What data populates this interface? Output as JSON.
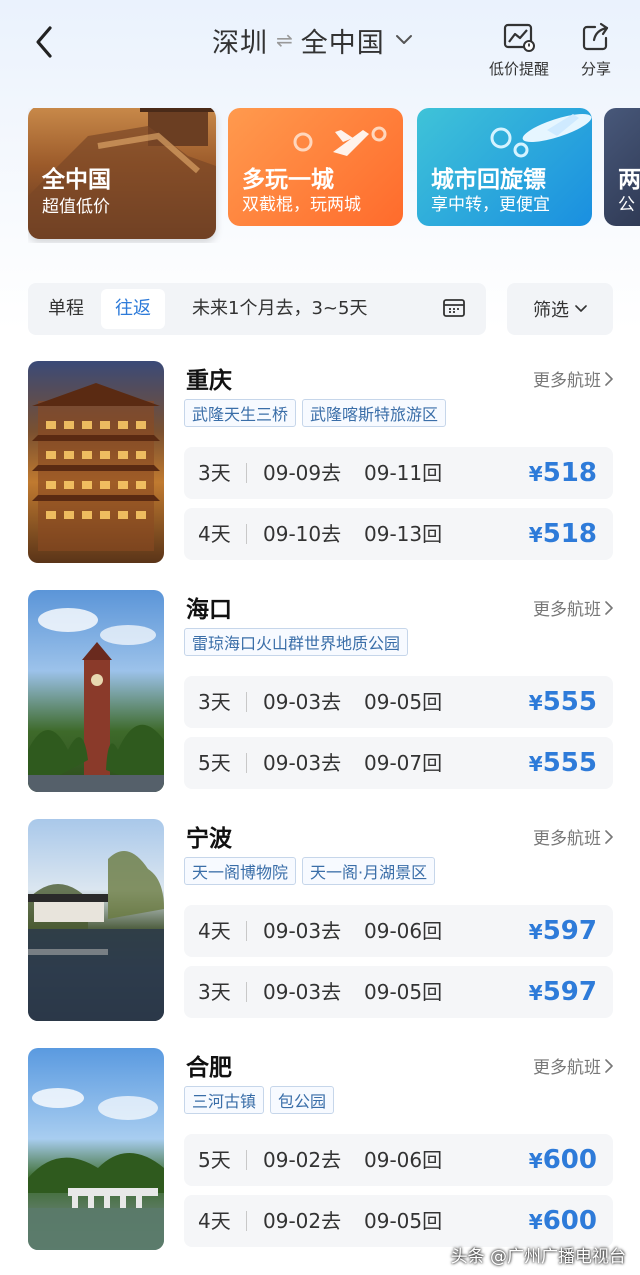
{
  "header": {
    "origin": "深圳",
    "swap_symbol": "⇌",
    "destination": "全中国",
    "price_alert_label": "低价提醒",
    "share_label": "分享"
  },
  "banners": [
    {
      "title": "全中国",
      "subtitle": "超值低价"
    },
    {
      "title": "多玩一城",
      "subtitle": "双截棍，玩两城"
    },
    {
      "title": "城市回旋镖",
      "subtitle": "享中转，更便宜"
    },
    {
      "title": "两",
      "subtitle": "公"
    }
  ],
  "filter": {
    "one_way": "单程",
    "round_trip": "往返",
    "date_range": "未来1个月去，3~5天",
    "filter_label": "筛选"
  },
  "more_flights_label": "更多航班",
  "destinations": [
    {
      "city": "重庆",
      "tags": [
        "武隆天生三桥",
        "武隆喀斯特旅游区"
      ],
      "flights": [
        {
          "days": "3天",
          "go": "09-09去",
          "back": "09-11回",
          "price": "518"
        },
        {
          "days": "4天",
          "go": "09-10去",
          "back": "09-13回",
          "price": "518"
        }
      ]
    },
    {
      "city": "海口",
      "tags": [
        "雷琼海口火山群世界地质公园"
      ],
      "flights": [
        {
          "days": "3天",
          "go": "09-03去",
          "back": "09-05回",
          "price": "555"
        },
        {
          "days": "5天",
          "go": "09-03去",
          "back": "09-07回",
          "price": "555"
        }
      ]
    },
    {
      "city": "宁波",
      "tags": [
        "天一阁博物院",
        "天一阁·月湖景区"
      ],
      "flights": [
        {
          "days": "4天",
          "go": "09-03去",
          "back": "09-06回",
          "price": "597"
        },
        {
          "days": "3天",
          "go": "09-03去",
          "back": "09-05回",
          "price": "597"
        }
      ]
    },
    {
      "city": "合肥",
      "tags": [
        "三河古镇",
        "包公园"
      ],
      "flights": [
        {
          "days": "5天",
          "go": "09-02去",
          "back": "09-06回",
          "price": "600"
        },
        {
          "days": "4天",
          "go": "09-02去",
          "back": "09-05回",
          "price": "600"
        }
      ]
    }
  ],
  "currency_symbol": "¥",
  "watermark": "头条 @广州广播电视台",
  "colors": {
    "accent": "#2e7bd9",
    "tag_text": "#3a6ea8",
    "row_bg": "#f5f6f8"
  }
}
